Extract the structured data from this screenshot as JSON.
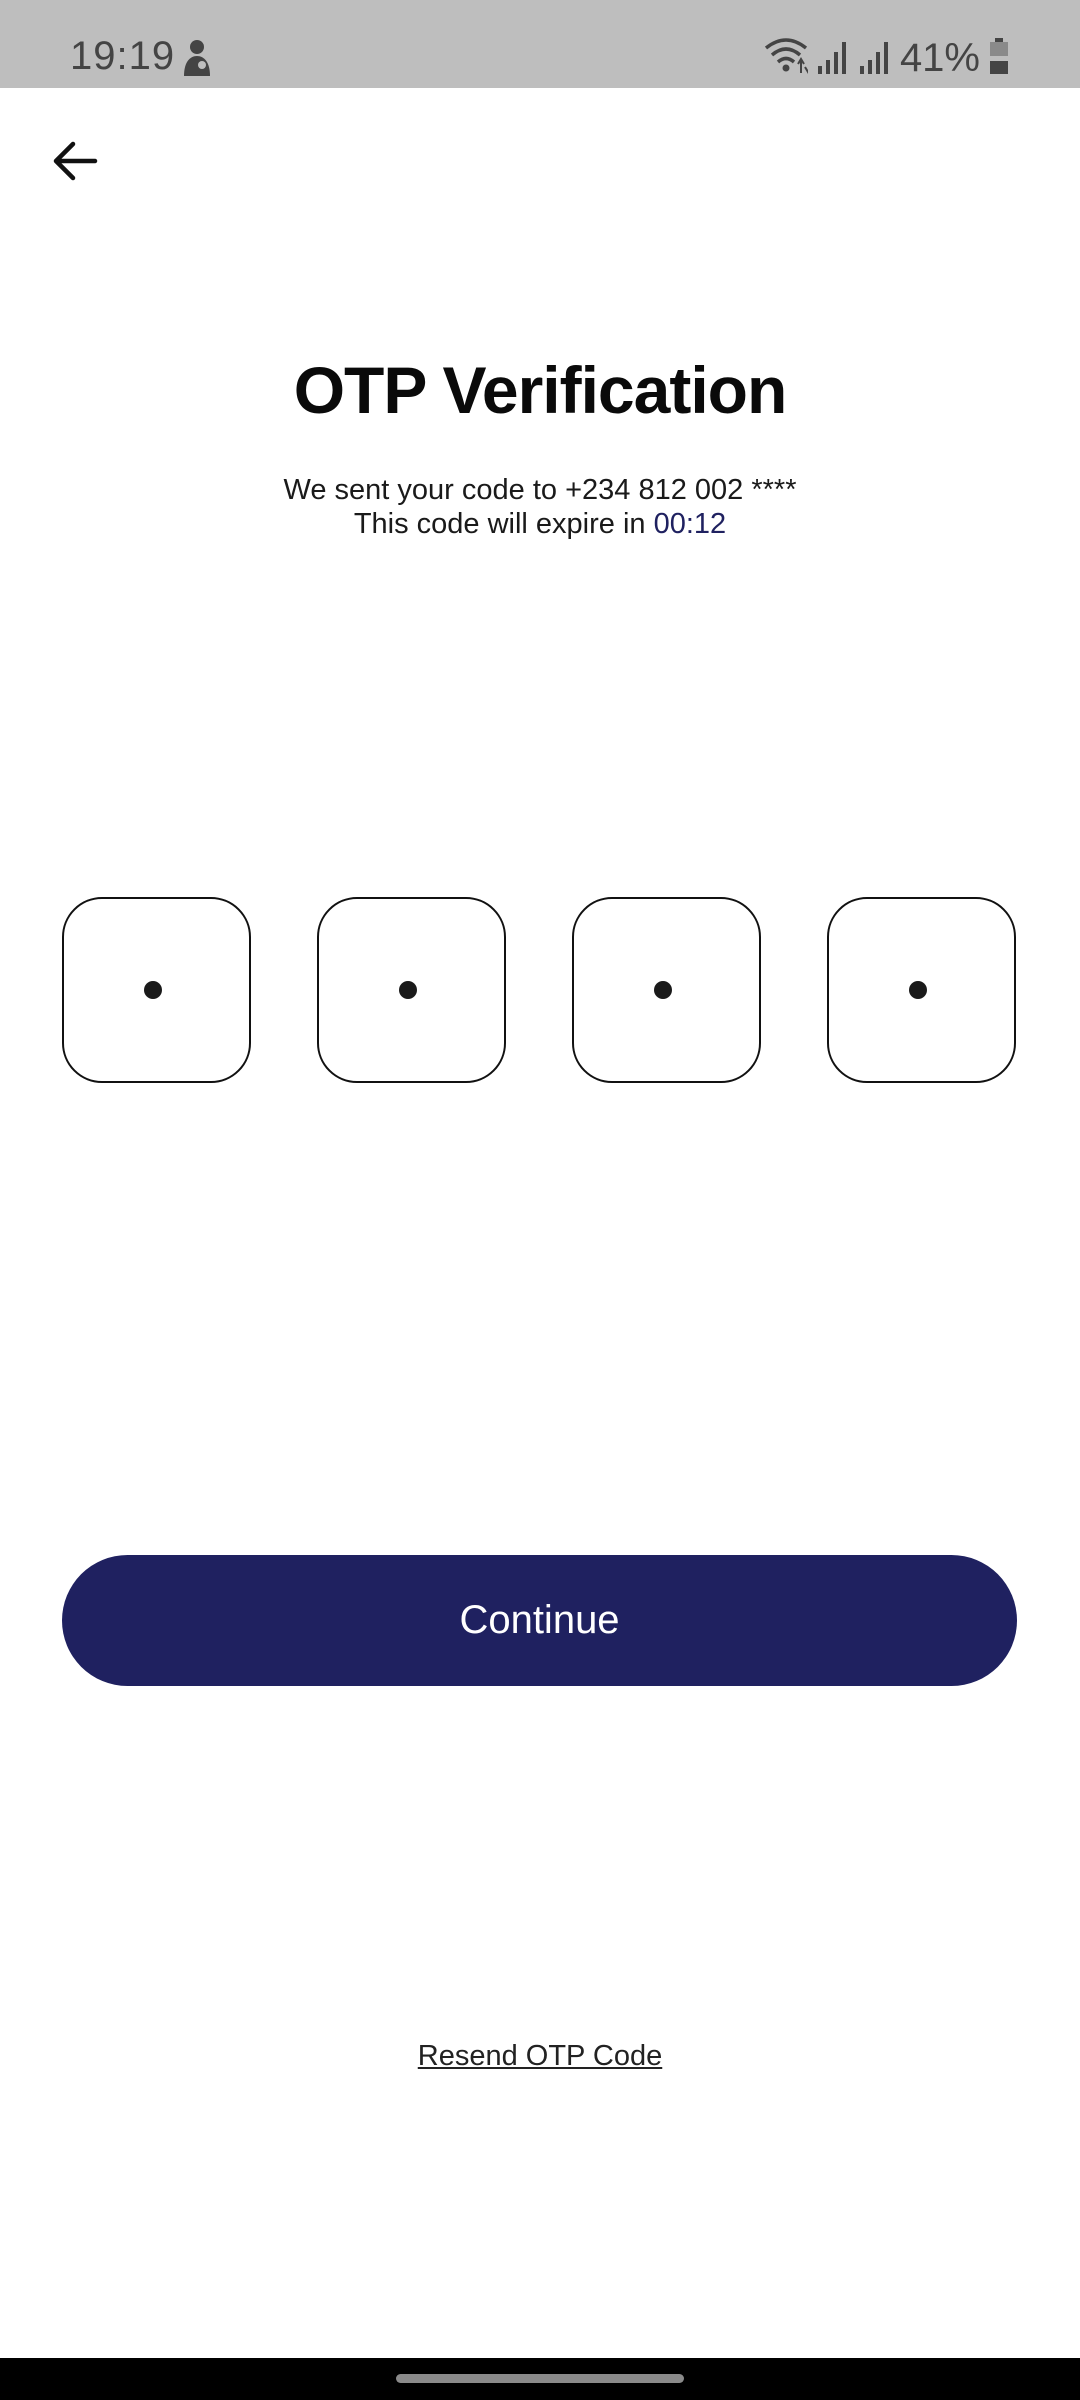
{
  "status_bar": {
    "time": "19:19",
    "battery_percent": "41%",
    "battery_level": 0.41,
    "icons": [
      "person-icon",
      "wifi-icon",
      "signal-icon",
      "signal-icon",
      "battery-icon"
    ]
  },
  "header": {
    "back_icon": "arrow-left-icon"
  },
  "main": {
    "title": "OTP Verification",
    "sent_prefix": "We sent your code to ",
    "phone": "+234 812 002 ****",
    "expire_prefix": "This code will expire in ",
    "timer": "00:12",
    "otp_digits": [
      "•",
      "•",
      "•",
      "•"
    ],
    "continue_label": "Continue",
    "resend_label": "Resend OTP Code"
  },
  "colors": {
    "accent": "#1f2160",
    "status_bar_bg": "#bebebe",
    "background": "#ffffff"
  }
}
